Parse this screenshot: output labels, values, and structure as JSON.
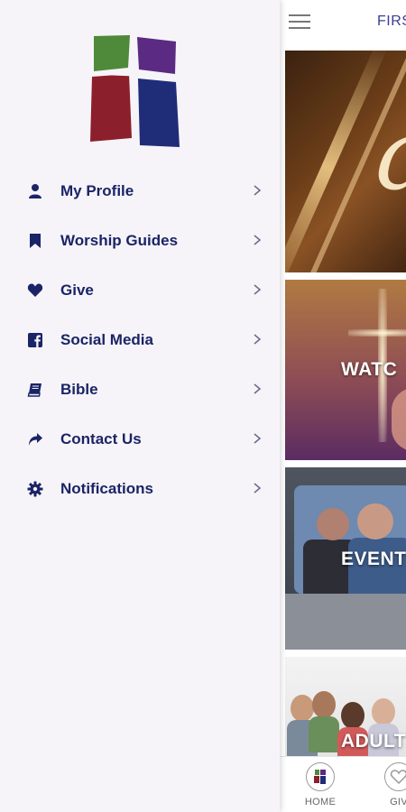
{
  "header": {
    "title": "FIRS",
    "menu_icon": "hamburger-menu-icon"
  },
  "tiles": [
    {
      "label": "",
      "script_text": "a",
      "image": "worship-banner"
    },
    {
      "label": "WATC",
      "image": "cross-light"
    },
    {
      "label": "EVENT",
      "image": "people-in-car"
    },
    {
      "label": "ADULT",
      "image": "group-of-adults"
    }
  ],
  "tabbar": [
    {
      "label": "HOME",
      "icon": "home-logo-icon"
    },
    {
      "label": "GIV",
      "icon": "heart-icon"
    }
  ],
  "drawer": {
    "logo": "church-cross-logo",
    "menu": [
      {
        "label": "My Profile",
        "icon": "user-icon"
      },
      {
        "label": "Worship Guides",
        "icon": "bookmark-icon"
      },
      {
        "label": "Give",
        "icon": "heart-icon"
      },
      {
        "label": "Social Media",
        "icon": "facebook-icon"
      },
      {
        "label": "Bible",
        "icon": "book-icon"
      },
      {
        "label": "Contact Us",
        "icon": "share-arrow-icon"
      },
      {
        "label": "Notifications",
        "icon": "gear-icon"
      }
    ]
  },
  "colors": {
    "drawer_bg": "#f6f4f8",
    "menu_text": "#1a2466",
    "chevron": "#6a6f8a",
    "logo_green": "#4f8a3a",
    "logo_purple": "#5b2a82",
    "logo_red": "#8c1f2c",
    "logo_navy": "#1f2d78"
  }
}
